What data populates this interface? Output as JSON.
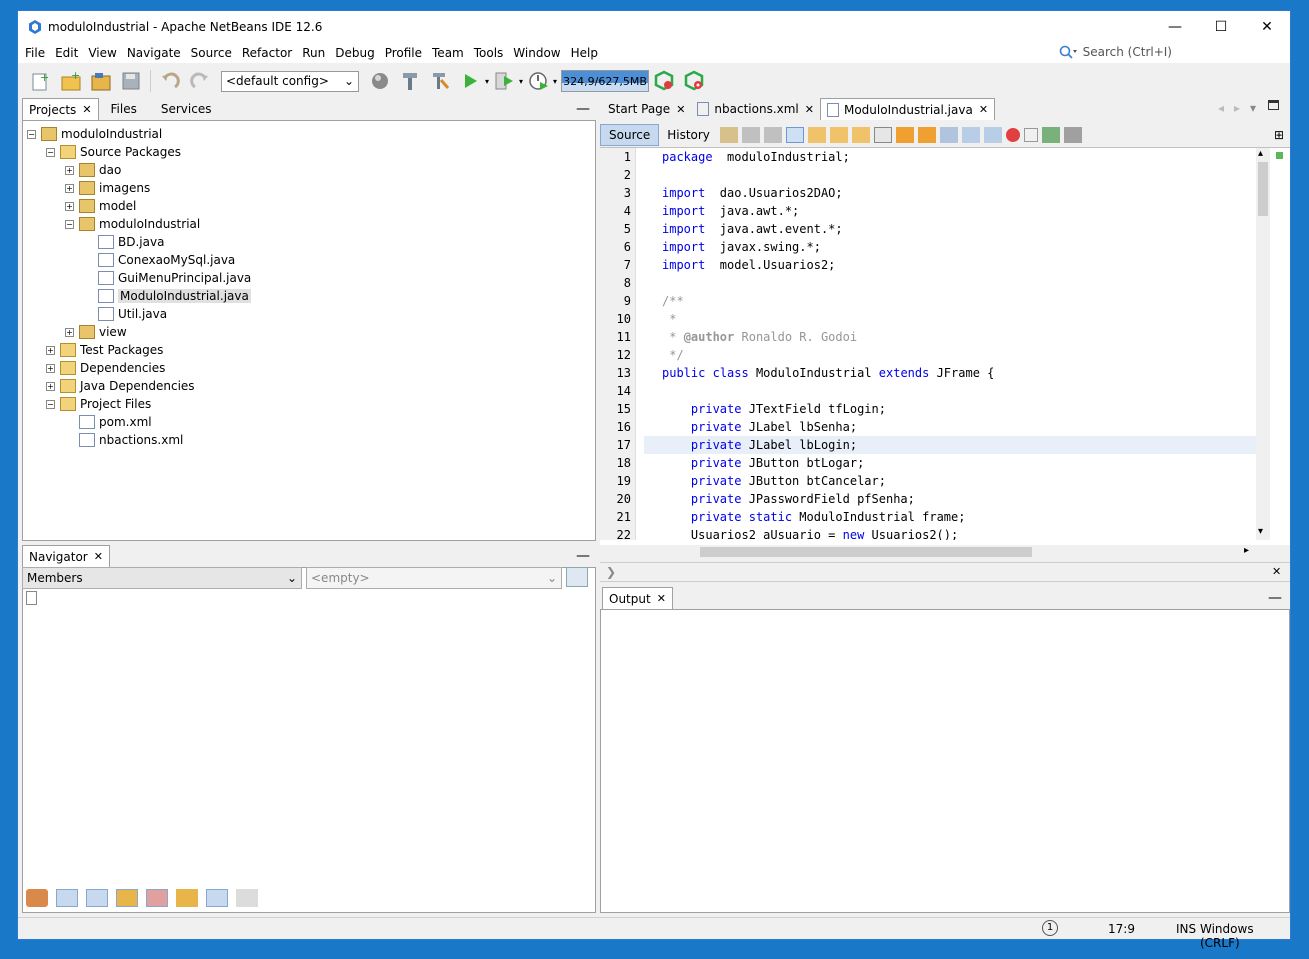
{
  "window": {
    "title": "moduloIndustrial - Apache NetBeans IDE 12.6",
    "minimize": "—",
    "maximize": "☐",
    "close": "✕"
  },
  "menu": [
    "File",
    "Edit",
    "View",
    "Navigate",
    "Source",
    "Refactor",
    "Run",
    "Debug",
    "Profile",
    "Team",
    "Tools",
    "Window",
    "Help"
  ],
  "search": {
    "placeholder": "Search (Ctrl+I)"
  },
  "toolbar": {
    "config": "<default config>",
    "memory": "324,9/627,5MB"
  },
  "projects_panel": {
    "tabs": [
      "Projects",
      "Files",
      "Services"
    ],
    "tree": [
      {
        "label": "moduloIndustrial",
        "level": 0,
        "icon": "project-icon",
        "exp": "−"
      },
      {
        "label": "Source Packages",
        "level": 1,
        "icon": "folder-icon",
        "exp": "−"
      },
      {
        "label": "dao",
        "level": 2,
        "icon": "package-icon",
        "exp": "+"
      },
      {
        "label": "imagens",
        "level": 2,
        "icon": "package-icon",
        "exp": "+"
      },
      {
        "label": "model",
        "level": 2,
        "icon": "package-icon",
        "exp": "+"
      },
      {
        "label": "moduloIndustrial",
        "level": 2,
        "icon": "package-icon",
        "exp": "−"
      },
      {
        "label": "BD.java",
        "level": 3,
        "icon": "java-file-icon",
        "exp": ""
      },
      {
        "label": "ConexaoMySql.java",
        "level": 3,
        "icon": "java-file-icon",
        "exp": ""
      },
      {
        "label": "GuiMenuPrincipal.java",
        "level": 3,
        "icon": "java-file-icon",
        "exp": ""
      },
      {
        "label": "ModuloIndustrial.java",
        "level": 3,
        "icon": "java-file-icon",
        "exp": "",
        "selected": true
      },
      {
        "label": "Util.java",
        "level": 3,
        "icon": "java-file-icon",
        "exp": ""
      },
      {
        "label": "view",
        "level": 2,
        "icon": "package-icon",
        "exp": "+"
      },
      {
        "label": "Test Packages",
        "level": 1,
        "icon": "folder-icon",
        "exp": "+"
      },
      {
        "label": "Dependencies",
        "level": 1,
        "icon": "folder-icon",
        "exp": "+"
      },
      {
        "label": "Java Dependencies",
        "level": 1,
        "icon": "folder-icon",
        "exp": "+"
      },
      {
        "label": "Project Files",
        "level": 1,
        "icon": "folder-icon",
        "exp": "−"
      },
      {
        "label": "pom.xml",
        "level": 2,
        "icon": "pom-icon",
        "exp": ""
      },
      {
        "label": "nbactions.xml",
        "level": 2,
        "icon": "xml-file-icon",
        "exp": ""
      }
    ]
  },
  "navigator": {
    "tab": "Navigator",
    "members": "Members",
    "filter": "<empty>"
  },
  "editor": {
    "tabs": [
      "Start Page",
      "nbactions.xml",
      "ModuloIndustrial.java"
    ],
    "source_btn": "Source",
    "history_btn": "History",
    "lines": [
      [
        [
          "kw",
          "package"
        ],
        [
          "",
          "  moduloIndustrial;"
        ]
      ],
      [],
      [
        [
          "kw",
          "import"
        ],
        [
          "",
          "  dao.Usuarios2DAO;"
        ]
      ],
      [
        [
          "kw",
          "import"
        ],
        [
          "",
          "  java.awt.*;"
        ]
      ],
      [
        [
          "kw",
          "import"
        ],
        [
          "",
          "  java.awt.event.*;"
        ]
      ],
      [
        [
          "kw",
          "import"
        ],
        [
          "",
          "  javax.swing.*;"
        ]
      ],
      [
        [
          "kw",
          "import"
        ],
        [
          "",
          "  model.Usuarios2;"
        ]
      ],
      [],
      [
        [
          "cm",
          "/**"
        ]
      ],
      [
        [
          "cm",
          " *"
        ]
      ],
      [
        [
          "cm",
          " * "
        ],
        [
          "ckw",
          "@author"
        ],
        [
          "cm",
          " Ronaldo R. Godoi"
        ]
      ],
      [
        [
          "cm",
          " */"
        ]
      ],
      [
        [
          "kw",
          "public"
        ],
        [
          "",
          " "
        ],
        [
          "kw",
          "class"
        ],
        [
          "",
          " ModuloIndustrial "
        ],
        [
          "kw",
          "extends"
        ],
        [
          "",
          " JFrame {"
        ]
      ],
      [],
      [
        [
          "",
          "    "
        ],
        [
          "kw",
          "private"
        ],
        [
          "",
          " JTextField tfLogin;"
        ]
      ],
      [
        [
          "",
          "    "
        ],
        [
          "kw",
          "private"
        ],
        [
          "",
          " JLabel lbSenha;"
        ]
      ],
      [
        [
          "",
          "    "
        ],
        [
          "kw",
          "private"
        ],
        [
          "",
          " JLabel lbLogin;"
        ]
      ],
      [
        [
          "",
          "    "
        ],
        [
          "kw",
          "private"
        ],
        [
          "",
          " JButton btLogar;"
        ]
      ],
      [
        [
          "",
          "    "
        ],
        [
          "kw",
          "private"
        ],
        [
          "",
          " JButton btCancelar;"
        ]
      ],
      [
        [
          "",
          "    "
        ],
        [
          "kw",
          "private"
        ],
        [
          "",
          " JPasswordField pfSenha;"
        ]
      ],
      [
        [
          "",
          "    "
        ],
        [
          "kw",
          "private"
        ],
        [
          "",
          " "
        ],
        [
          "kw",
          "static"
        ],
        [
          "",
          " ModuloIndustrial frame;"
        ]
      ],
      [
        [
          "",
          "    Usuarios2 aUsuario = "
        ],
        [
          "kw",
          "new"
        ],
        [
          "",
          " Usuarios2();"
        ]
      ]
    ],
    "line_numbers": [
      "1",
      "2",
      "3",
      "4",
      "5",
      "6",
      "7",
      "8",
      "9",
      "10",
      "11",
      "12",
      "13",
      "14",
      "15",
      "16",
      "17",
      "18",
      "19",
      "20",
      "21",
      "22"
    ],
    "highlight_line": 17
  },
  "output": {
    "tab": "Output"
  },
  "status": {
    "position": "17:9",
    "mode": "INS",
    "line_ending": "Windows (CRLF)"
  },
  "colors": {
    "keyword": "#0000e6",
    "comment": "#969696",
    "selection": "#e9eff8"
  }
}
